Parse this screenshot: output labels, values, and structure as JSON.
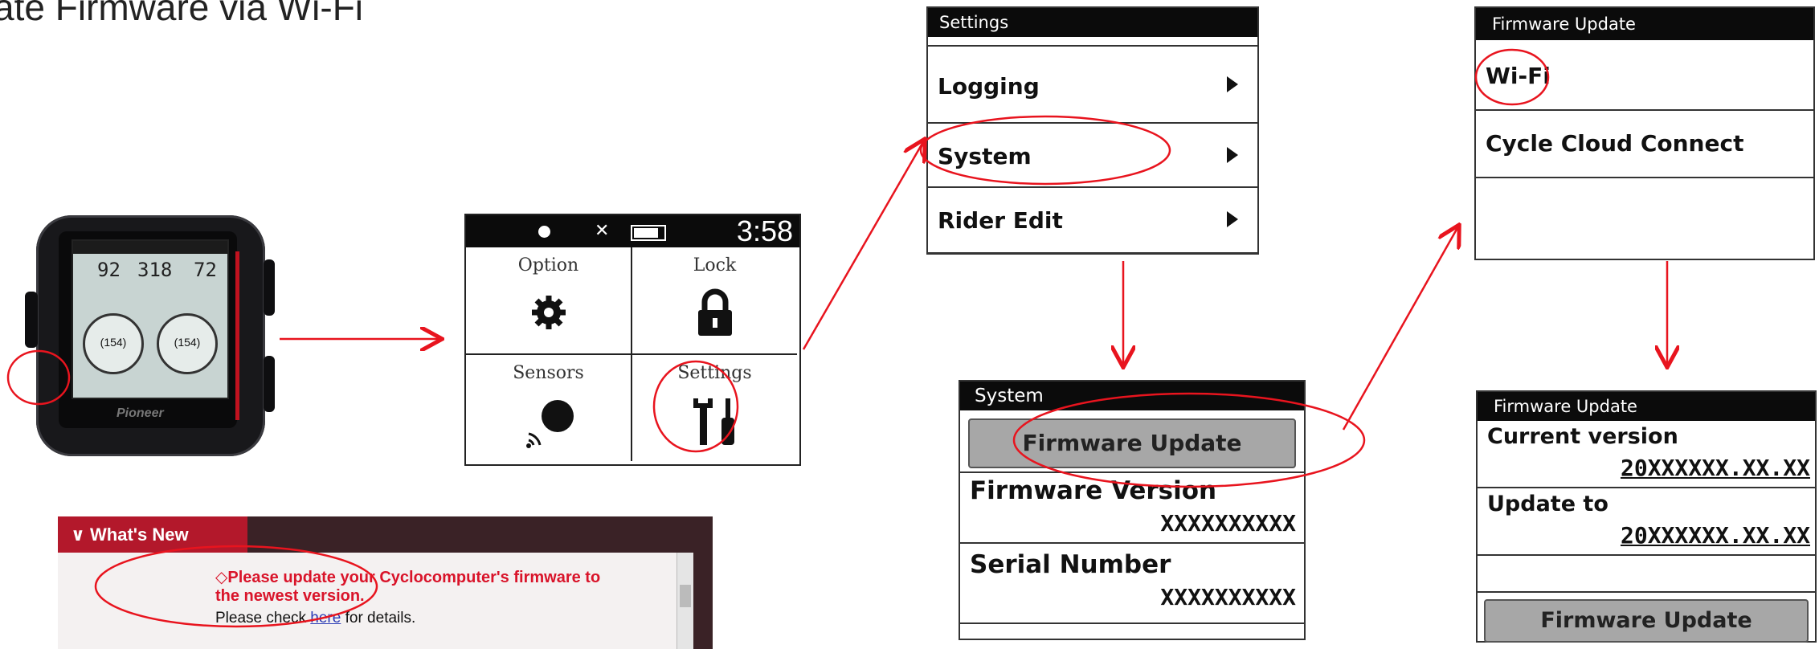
{
  "page_title": "ate Firmware via Wi-Fi",
  "device": {
    "values": [
      "92",
      "318",
      "72"
    ],
    "dial_left": "(154)",
    "dial_right": "(154)",
    "brand": "Pioneer"
  },
  "main_menu": {
    "clock": "3:58",
    "cells": [
      {
        "label": "Option",
        "icon": "gear-icon"
      },
      {
        "label": "Lock",
        "icon": "lock-icon"
      },
      {
        "label": "Sensors",
        "icon": "wireless-sensor-icon"
      },
      {
        "label": "Settings",
        "icon": "wrench-screwdriver-icon"
      }
    ]
  },
  "settings_panel": {
    "header": "Settings",
    "items": [
      "Logging",
      "System",
      "Rider Edit"
    ]
  },
  "system_panel": {
    "header": "System",
    "button": "Firmware Update",
    "firmware_version_label": "Firmware Version",
    "firmware_version_value": "XXXXXXXXXX",
    "serial_label": "Serial Number",
    "serial_value": "XXXXXXXXXX"
  },
  "fw_menu_panel": {
    "header": "Firmware Update",
    "items": [
      "Wi-Fi",
      "Cycle Cloud Connect"
    ]
  },
  "fw_update_panel": {
    "header": "Firmware Update",
    "current_label": "Current version",
    "current_value": "20XXXXXX.XX.XX",
    "update_label": "Update to",
    "update_value": "20XXXXXX.XX.XX",
    "button": "Firmware Update"
  },
  "whats_new": {
    "tab": "What's New",
    "line1": "◇Please update your Cyclocomputer's firmware to",
    "line2": "the newest version.",
    "line3_pre": "Please check ",
    "line3_link": "here",
    "line3_post": " for details."
  },
  "colors": {
    "highlight": "#e8141e",
    "header_bg": "#0b0b0b",
    "news_tab": "#b3182b"
  }
}
